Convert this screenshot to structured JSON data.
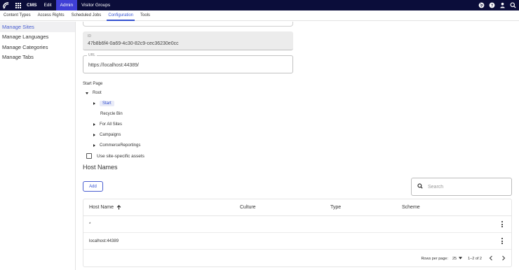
{
  "topbar": {
    "app_label": "CMS",
    "items": [
      {
        "label": "Edit"
      },
      {
        "label": "Admin"
      },
      {
        "label": "Visitor Groups"
      }
    ]
  },
  "subnav": {
    "items": [
      {
        "label": "Content Types"
      },
      {
        "label": "Access Rights"
      },
      {
        "label": "Scheduled Jobs"
      },
      {
        "label": "Configuration"
      },
      {
        "label": "Tools"
      }
    ]
  },
  "sidebar": {
    "items": [
      {
        "label": "Manage Sites"
      },
      {
        "label": "Manage Languages"
      },
      {
        "label": "Manage Categories"
      },
      {
        "label": "Manage Tabs"
      }
    ]
  },
  "form": {
    "id_label": "ID",
    "id_value": "47b8b6f4-0a69-4c30-82c9-cec36230e0cc",
    "url_label": "URL",
    "url_value": "https://localhost:44389/"
  },
  "start_page": {
    "label": "Start Page",
    "root": "Root",
    "children": [
      {
        "label": "Start"
      },
      {
        "label": "Recycle Bin"
      },
      {
        "label": "For All Sites"
      },
      {
        "label": "Campaigns"
      },
      {
        "label": "CommerceReportings"
      }
    ]
  },
  "site_assets_label": "Use site-specific assets",
  "host_names": {
    "title": "Host Names",
    "add_label": "Add",
    "search_placeholder": "Search",
    "columns": {
      "host_name": "Host Name",
      "culture": "Culture",
      "type": "Type",
      "scheme": "Scheme"
    },
    "rows": [
      {
        "host_name": "*",
        "culture": "",
        "type": "",
        "scheme": ""
      },
      {
        "host_name": "localhost:44389",
        "culture": "",
        "type": "",
        "scheme": ""
      }
    ],
    "footer": {
      "rows_per_page_label": "Rows per page:",
      "rows_per_page_value": "25",
      "range": "1–2 of 2"
    }
  },
  "colors": {
    "topbar_bg": "#0b0d3a",
    "active_admin": "#3f3fd6",
    "accent": "#3451d1"
  }
}
